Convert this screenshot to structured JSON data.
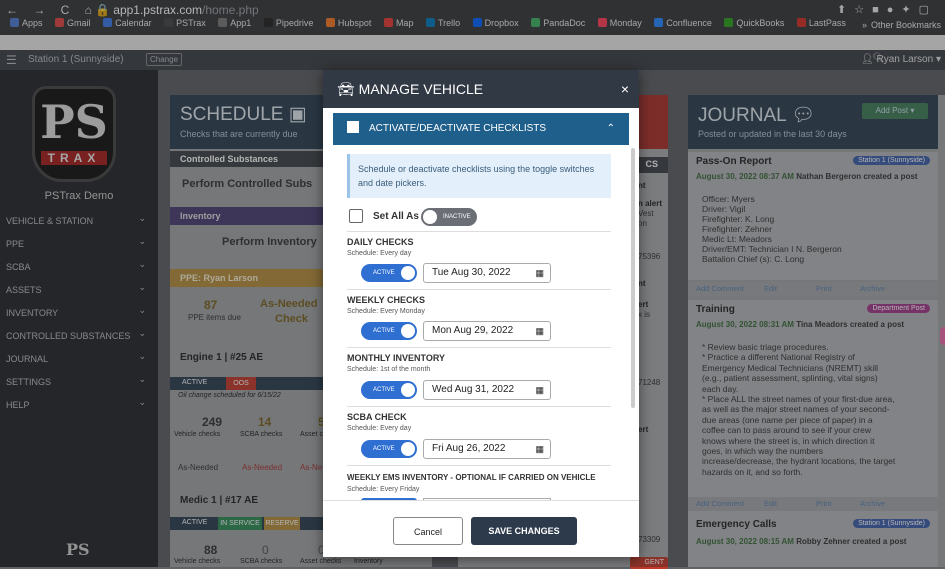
{
  "browser": {
    "url_domain": "app1.pstrax.com",
    "url_path": "/home.php",
    "nav": "← → C ⌂",
    "bookmarks": [
      "Apps",
      "Gmail",
      "Calendar",
      "PSTrax",
      "App1",
      "Pipedrive",
      "Hubspot",
      "Map",
      "Trello",
      "Dropbox",
      "PandaDoc",
      "Monday",
      "Confluence",
      "QuickBooks",
      "LastPass"
    ],
    "other_bookmarks": "Other Bookmarks",
    "overflow": "»"
  },
  "appbar": {
    "station": "Station 1 (Sunnyside)",
    "change": "Change",
    "user": "Ryan Larson"
  },
  "sidebar": {
    "logo_ps": "PS",
    "logo_trax": "TRAX",
    "demo": "PSTrax Demo",
    "items": [
      "VEHICLE & STATION",
      "PPE",
      "SCBA",
      "ASSETS",
      "INVENTORY",
      "CONTROLLED SUBSTANCES",
      "JOURNAL",
      "SETTINGS",
      "HELP"
    ]
  },
  "schedule": {
    "title": "SCHEDULE",
    "subtitle": "Checks that are currently due",
    "cs_header": "Controlled Substances",
    "cs_task": "Perform Controlled Subs",
    "inv_header": "Inventory",
    "inv_task": "Perform Inventory",
    "ppe_header": "PPE: Ryan Larson",
    "ppe_count": "87",
    "ppe_count_label": "PPE items due",
    "ppe_asneeded": "As-Needed",
    "ppe_check": "Check",
    "engine_title": "Engine 1 | #25 AE",
    "engine_status1": "ACTIVE",
    "engine_status2": "OOS",
    "engine_note": "Oil change scheduled for 6/15/22",
    "engine_counts": [
      "249",
      "14",
      "5"
    ],
    "engine_count_labels": [
      "Vehicle checks",
      "SCBA checks",
      "Asset c"
    ],
    "engine_asneeded": [
      "As-Needed",
      "As-Needed",
      "As-Ne"
    ],
    "medic_title": "Medic 1 | #17 AE",
    "medic_status": [
      "ACTIVE",
      "IN SERVICE",
      "RESERVE"
    ],
    "medic_counts": [
      "88",
      "0",
      "0"
    ],
    "medic_count_labels": [
      "Vehicle checks",
      "SCBA checks",
      "Asset checks",
      "Inventory"
    ]
  },
  "alerts": {
    "cs": "CS",
    "codes": [
      "75396",
      "71248",
      "73309"
    ],
    "snips": [
      "nt",
      "n alert",
      "Vest",
      "on",
      "nt",
      "nt",
      "ert",
      "x is",
      "ert",
      "GENT"
    ]
  },
  "journal": {
    "title": "JOURNAL",
    "subtitle": "Posted or updated in the last 30 days",
    "add_post": "Add Post",
    "posts": [
      {
        "title": "Pass-On Report",
        "badge": "Station 1 (Sunnyside)",
        "meta": "August 30, 2022 08:37 AM",
        "author": "Nathan Bergeron created a post",
        "lines": [
          "Officer: Myers",
          "Driver: Vigil",
          "Firefighter: K. Long",
          "Firefighter: Zehner",
          "Medic Lt: Meadors",
          "Driver/EMT: Technician I N. Bergeron",
          "Battalion Chief (s): C. Long"
        ]
      },
      {
        "title": "Training",
        "badge": "Department Post",
        "meta": "August 30, 2022 08:31 AM",
        "author": "Tina Meadors created a post",
        "lines": [
          "* Review basic triage procedures.",
          "* Practice a different National Registry of",
          "Emergency Medical Technicians (NREMT) skill",
          "(e.g., patient assessment, splinting, vital signs)",
          "each day.",
          "* Place ALL the street names of your first-due area,",
          "as well as the major street names of your second-",
          "due areas (one name per piece of paper) in a",
          "coffee can to pass around to see if your crew",
          "knows where the street is, in which direction it",
          "goes, in which way the numbers",
          "increase/decrease, the hydrant locations, the target",
          "hazards on it, and so forth."
        ]
      },
      {
        "title": "Emergency Calls",
        "badge": "Station 1 (Sunnyside)",
        "meta": "August 30, 2022 08:15 AM",
        "author": "Robby Zehner created a post"
      }
    ],
    "actions": [
      "Add Comment",
      "Edit",
      "Print",
      "Archive"
    ]
  },
  "modal": {
    "title": "MANAGE VEHICLE",
    "close": "×",
    "section": "ACTIVATE/DEACTIVATE CHECKLISTS",
    "info": "Schedule or deactivate checklists using the toggle switches and date pickers.",
    "set_all": "Set All As",
    "set_all_state": "INACTIVE",
    "checks": [
      {
        "name": "DAILY CHECKS",
        "schedule": "Schedule: Every day",
        "state": "ACTIVE",
        "date": "Tue Aug 30, 2022"
      },
      {
        "name": "WEEKLY CHECKS",
        "schedule": "Schedule: Every Monday",
        "state": "ACTIVE",
        "date": "Mon Aug 29, 2022"
      },
      {
        "name": "MONTHLY INVENTORY",
        "schedule": "Schedule: 1st of the month",
        "state": "ACTIVE",
        "date": "Wed Aug 31, 2022"
      },
      {
        "name": "SCBA CHECK",
        "schedule": "Schedule: Every day",
        "state": "ACTIVE",
        "date": "Fri Aug 26, 2022"
      },
      {
        "name": "WEEKLY EMS INVENTORY - OPTIONAL IF CARRIED ON VEHICLE",
        "schedule": "Schedule: Every Friday"
      }
    ],
    "cancel": "Cancel",
    "save": "SAVE CHANGES"
  }
}
